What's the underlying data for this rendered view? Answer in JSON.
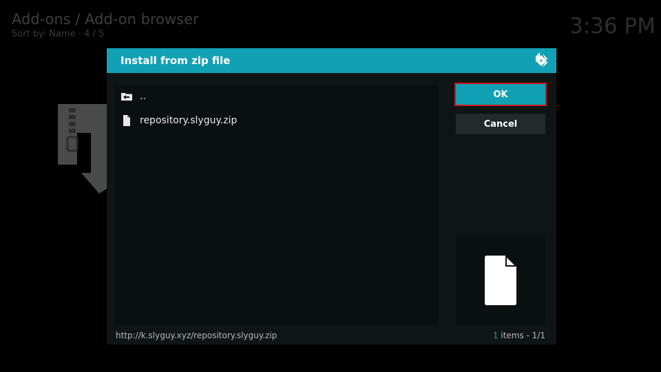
{
  "header": {
    "title": "Add-ons / Add-on browser",
    "sort_label": "Sort by: Name",
    "separator": "·",
    "position": "4 / 5",
    "clock": "3:36 PM"
  },
  "dialog": {
    "title": "Install from zip file",
    "logo_icon": "kodi-logo-icon",
    "items": [
      {
        "label": "..",
        "icon": "parent-folder-icon"
      },
      {
        "label": "repository.slyguy.zip",
        "icon": "file-icon"
      }
    ],
    "buttons": {
      "ok": "OK",
      "cancel": "Cancel"
    },
    "preview_icon": "file-icon",
    "footer": {
      "path": "http://k.slyguy.xyz/repository.slyguy.zip",
      "count": "1",
      "count_suffix": " items - 1/1"
    }
  },
  "colors": {
    "accent": "#12a0b4",
    "highlight_border": "#d0131a",
    "dialog_bg": "#0f1515"
  }
}
